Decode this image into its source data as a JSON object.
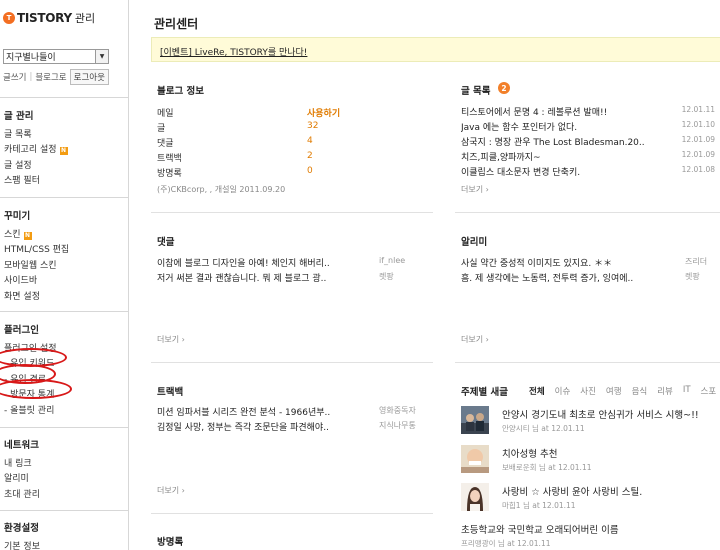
{
  "brand": {
    "mark": "T",
    "name": "TISTORY",
    "sub": "관리"
  },
  "blog_select": {
    "value": "지구별나들이"
  },
  "account": {
    "write": "글쓰기",
    "blog_home": "블로그로",
    "logout": "로그아웃"
  },
  "sidebar": {
    "posts": {
      "title": "글 관리",
      "items": [
        "글 목록",
        "카테고리 설정",
        "글 설정",
        "스팸 필터"
      ]
    },
    "design": {
      "title": "꾸미기",
      "items": [
        "스킨",
        "HTML/CSS 편집",
        "모바일웹 스킨",
        "사이드바",
        "화면 설정"
      ]
    },
    "plugins": {
      "title": "플러그인",
      "items": [
        "플러그인 설정",
        "- 유입 키워드",
        "- 유입 경로",
        "- 방문자 통계",
        "- 올블릿 관리"
      ]
    },
    "network": {
      "title": "네트워크",
      "items": [
        "내 링크",
        "알리미",
        "초대 관리"
      ]
    },
    "settings": {
      "title": "환경설정",
      "items": [
        "기본 정보"
      ]
    },
    "new_badge": "N"
  },
  "main": {
    "title": "관리센터",
    "event": "[이벤트] LiveRe, TISTORY를 만나다!"
  },
  "blog_info": {
    "title": "블로그 정보",
    "rows": [
      {
        "label": "메일",
        "value": "사용하기"
      },
      {
        "label": "글",
        "value": "32"
      },
      {
        "label": "댓글",
        "value": "4"
      },
      {
        "label": "트랙백",
        "value": "2"
      },
      {
        "label": "방명록",
        "value": "0"
      }
    ],
    "footer": "(주)CKBcorp, , 개설일 2011.09.20"
  },
  "post_list": {
    "title": "글 목록",
    "count": "2",
    "rows": [
      {
        "title": "티스토어에서 문명 4 : 레볼루션 발매!!",
        "date": "12.01.11"
      },
      {
        "title": "Java 에는 함수 포인터가 없다.",
        "date": "12.01.10"
      },
      {
        "title": "삼국지 : 명장 관우 The Lost Bladesman.20..",
        "date": "12.01.09"
      },
      {
        "title": "치즈,피클,양파까지~",
        "date": "12.01.09"
      },
      {
        "title": "이클립스 대소문자 변경 단축키.",
        "date": "12.01.08"
      }
    ],
    "more": "더보기 ›"
  },
  "comments": {
    "title": "댓글",
    "rows": [
      {
        "text": "이참에 블로그 디자인을 아예! 체인지 해버리..",
        "author": "if_nlee"
      },
      {
        "text": "저거 써본 결과 괜찮습니다. 뭐 제 블로그 광..",
        "author": "렛팡"
      }
    ],
    "more": "더보기 ›"
  },
  "notifier": {
    "title": "알리미",
    "rows": [
      {
        "text": "사실 약간 중성적 이미지도 있지요. ＊＊",
        "author": "즈리더"
      },
      {
        "text": "흠. 제 생각에는 노동력, 전투력 증가, 잉여에..",
        "author": "렛팡"
      }
    ],
    "more": "더보기 ›"
  },
  "trackbacks": {
    "title": "트랙백",
    "rows": [
      {
        "text": "미션 임파서블 시리즈 완전 분석 - 1966년부..",
        "author": "영화중독자"
      },
      {
        "text": "김정일 사망, 정부는 즉각 조문단을 파견해야..",
        "author": "지식나무통"
      }
    ],
    "more": "더보기 ›"
  },
  "guestbook": {
    "title": "방명록"
  },
  "topic_posts": {
    "title": "주제별 새글",
    "tabs": [
      "전체",
      "이슈",
      "사진",
      "여행",
      "음식",
      "리뷰",
      "IT",
      "스포"
    ],
    "items": [
      {
        "title": "안양시 경기도내 최초로 안심귀가 서비스 시행~!!",
        "meta": "안양시티 님 at 12.01.11"
      },
      {
        "title": "치아성형 추천",
        "meta": "보배로운회 님 at 12.01.11"
      },
      {
        "title": "사랑비 ☆ 사랑비 윤아 사랑비 스틸.",
        "meta": "마힙1 님 at 12.01.11"
      },
      {
        "title": "초등학교와 국민학교 오래되어버린 이름",
        "meta": "프리맹광이 님 at 12.01.11"
      }
    ]
  },
  "colors": {
    "accent": "#e07b00",
    "annotation": "#d81818",
    "event_bg": "#fffbd8"
  }
}
